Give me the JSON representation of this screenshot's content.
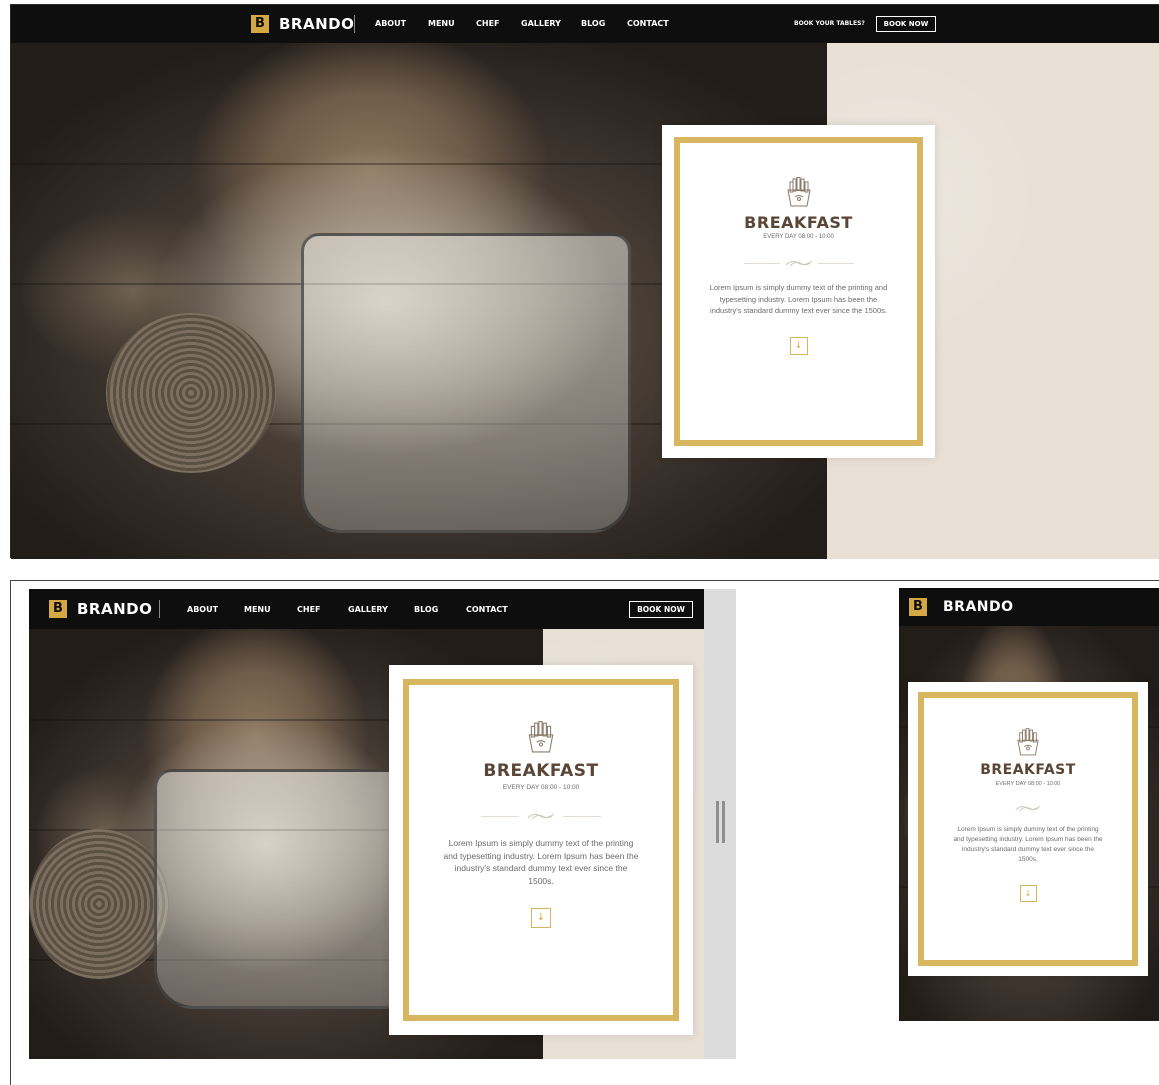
{
  "brand": {
    "logo_letter": "B",
    "name": "BRANDO"
  },
  "nav": {
    "items": [
      "ABOUT",
      "MENU",
      "CHEF",
      "GALLERY",
      "BLOG",
      "CONTACT"
    ],
    "book_tables_label": "BOOK YOUR TABLES?",
    "book_now_label": "BOOK NOW"
  },
  "card": {
    "title": "BREAKFAST",
    "subtitle": "EVERY DAY 08:00 - 10:00",
    "body": "Lorem Ipsum is simply dummy text of the printing and typesetting industry. Lorem Ipsum has been the industry's standard dummy text ever since the 1500s.",
    "icon": "fries-icon",
    "ornament": "flourish-icon",
    "button_icon": "arrow-down-icon"
  },
  "colors": {
    "accent": "#d4a943",
    "frame": "#d7b65f",
    "nav_bg": "#0e0e0e",
    "title": "#5a4636",
    "beige": "#e8dfd5"
  }
}
